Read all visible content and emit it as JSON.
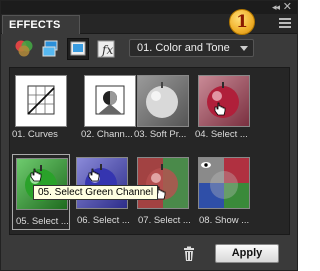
{
  "panel": {
    "tab_label": "EFFECTS",
    "collapse_glyph": "◂◂",
    "close_glyph": "✕"
  },
  "toolbar": {
    "tools": [
      {
        "name": "filters-icon"
      },
      {
        "name": "layer-styles-icon"
      },
      {
        "name": "photo-effects-icon"
      },
      {
        "name": "text-effects-icon"
      }
    ],
    "category": "01. Color and Tone"
  },
  "badge": "1",
  "effects": [
    {
      "label": "01. Curves"
    },
    {
      "label": "02. Chann..."
    },
    {
      "label": "03. Soft Pr..."
    },
    {
      "label": "04. Select ..."
    },
    {
      "label": "05. Select ..."
    },
    {
      "label": "06. Select ..."
    },
    {
      "label": "07. Select ..."
    },
    {
      "label": "08. Show ..."
    }
  ],
  "tooltip": "05. Select Green Channel",
  "footer": {
    "apply_label": "Apply"
  },
  "colors": {
    "panel_bg": "#3a3a3a",
    "grid_bg": "#262626",
    "badge": "#f0b02a"
  }
}
